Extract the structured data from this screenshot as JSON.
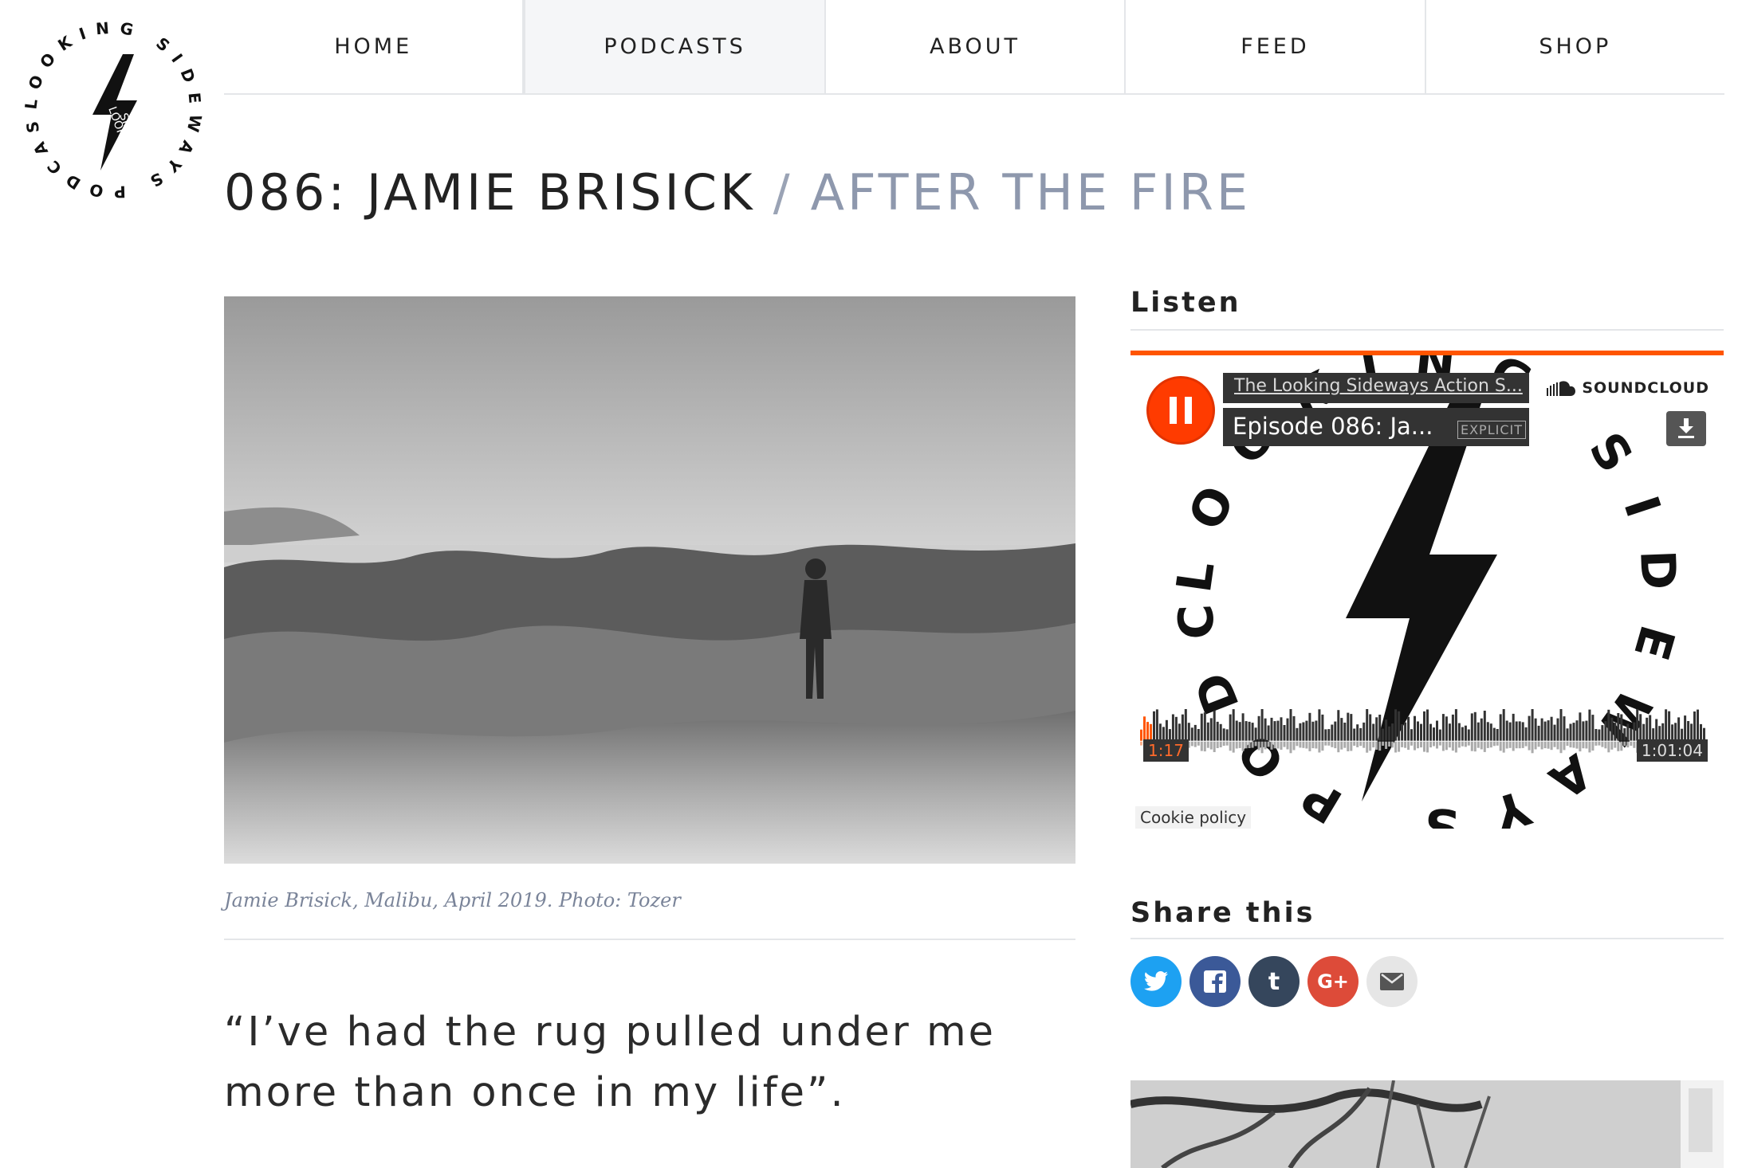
{
  "logo": {
    "alt": "Looking Sideways Podcast",
    "ring_text": "LOOKING SIDEWAYS PODCAST",
    "word_1": "LOOKING",
    "word_2": "SIDEWAYS"
  },
  "nav": {
    "items": [
      {
        "label": "HOME",
        "active": false
      },
      {
        "label": "PODCASTS",
        "active": true
      },
      {
        "label": "ABOUT",
        "active": false
      },
      {
        "label": "FEED",
        "active": false
      },
      {
        "label": "SHOP",
        "active": false
      }
    ]
  },
  "title": {
    "main": "086: JAMIE BRISICK",
    "separator": "/",
    "subtitle": "AFTER THE FIRE"
  },
  "hero": {
    "caption": "Jamie Brisick, Malibu, April 2019. Photo: Tozer"
  },
  "quote": "“I’ve had the rug pulled under me more than once in my life”.",
  "sidebar": {
    "listen_heading": "Listen",
    "share_heading": "Share this",
    "player": {
      "artist": "The Looking Sideways Action S...",
      "track": "Episode 086: Ja...",
      "explicit": "EXPLICIT",
      "brand": "SOUNDCLOUD",
      "current_time": "1:17",
      "total_time": "1:01:04",
      "progress": 0.021,
      "cookie": "Cookie policy",
      "accent": "#ff5500"
    },
    "share": [
      {
        "name": "twitter",
        "glyph": "t",
        "color": "#1da1f2"
      },
      {
        "name": "facebook",
        "glyph": "f",
        "color": "#3b5998"
      },
      {
        "name": "tumblr",
        "glyph": "t",
        "color": "#35465c"
      },
      {
        "name": "google-plus",
        "glyph": "G+",
        "color": "#dd4b39"
      },
      {
        "name": "email",
        "glyph": "✉",
        "color": "#e6e6e6"
      }
    ]
  }
}
